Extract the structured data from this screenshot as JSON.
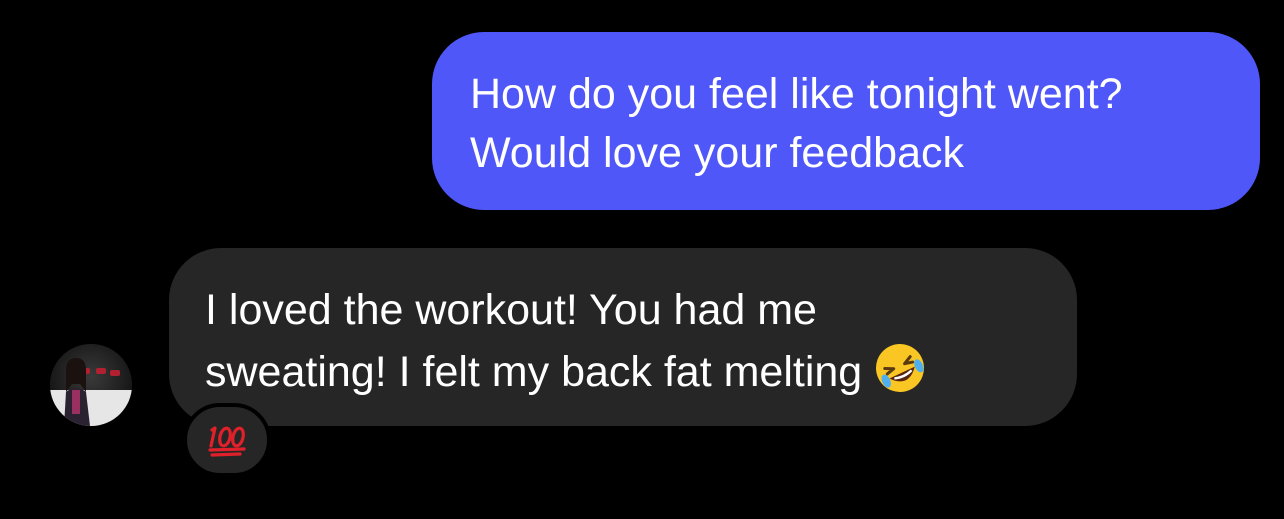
{
  "conversation": {
    "outgoing": {
      "line1": "How do you feel like tonight went?",
      "line2": "Would love your feedback"
    },
    "incoming": {
      "line1": "I loved the workout! You had me",
      "line2": "sweating! I felt my back fat melting",
      "emoji": "rolling-on-floor-laughing-emoji",
      "reaction": "hundred-points-emoji"
    }
  },
  "colors": {
    "background": "#000000",
    "outgoing_bubble": "#5057F8",
    "incoming_bubble": "#262626",
    "text": "#FFFFFF"
  }
}
